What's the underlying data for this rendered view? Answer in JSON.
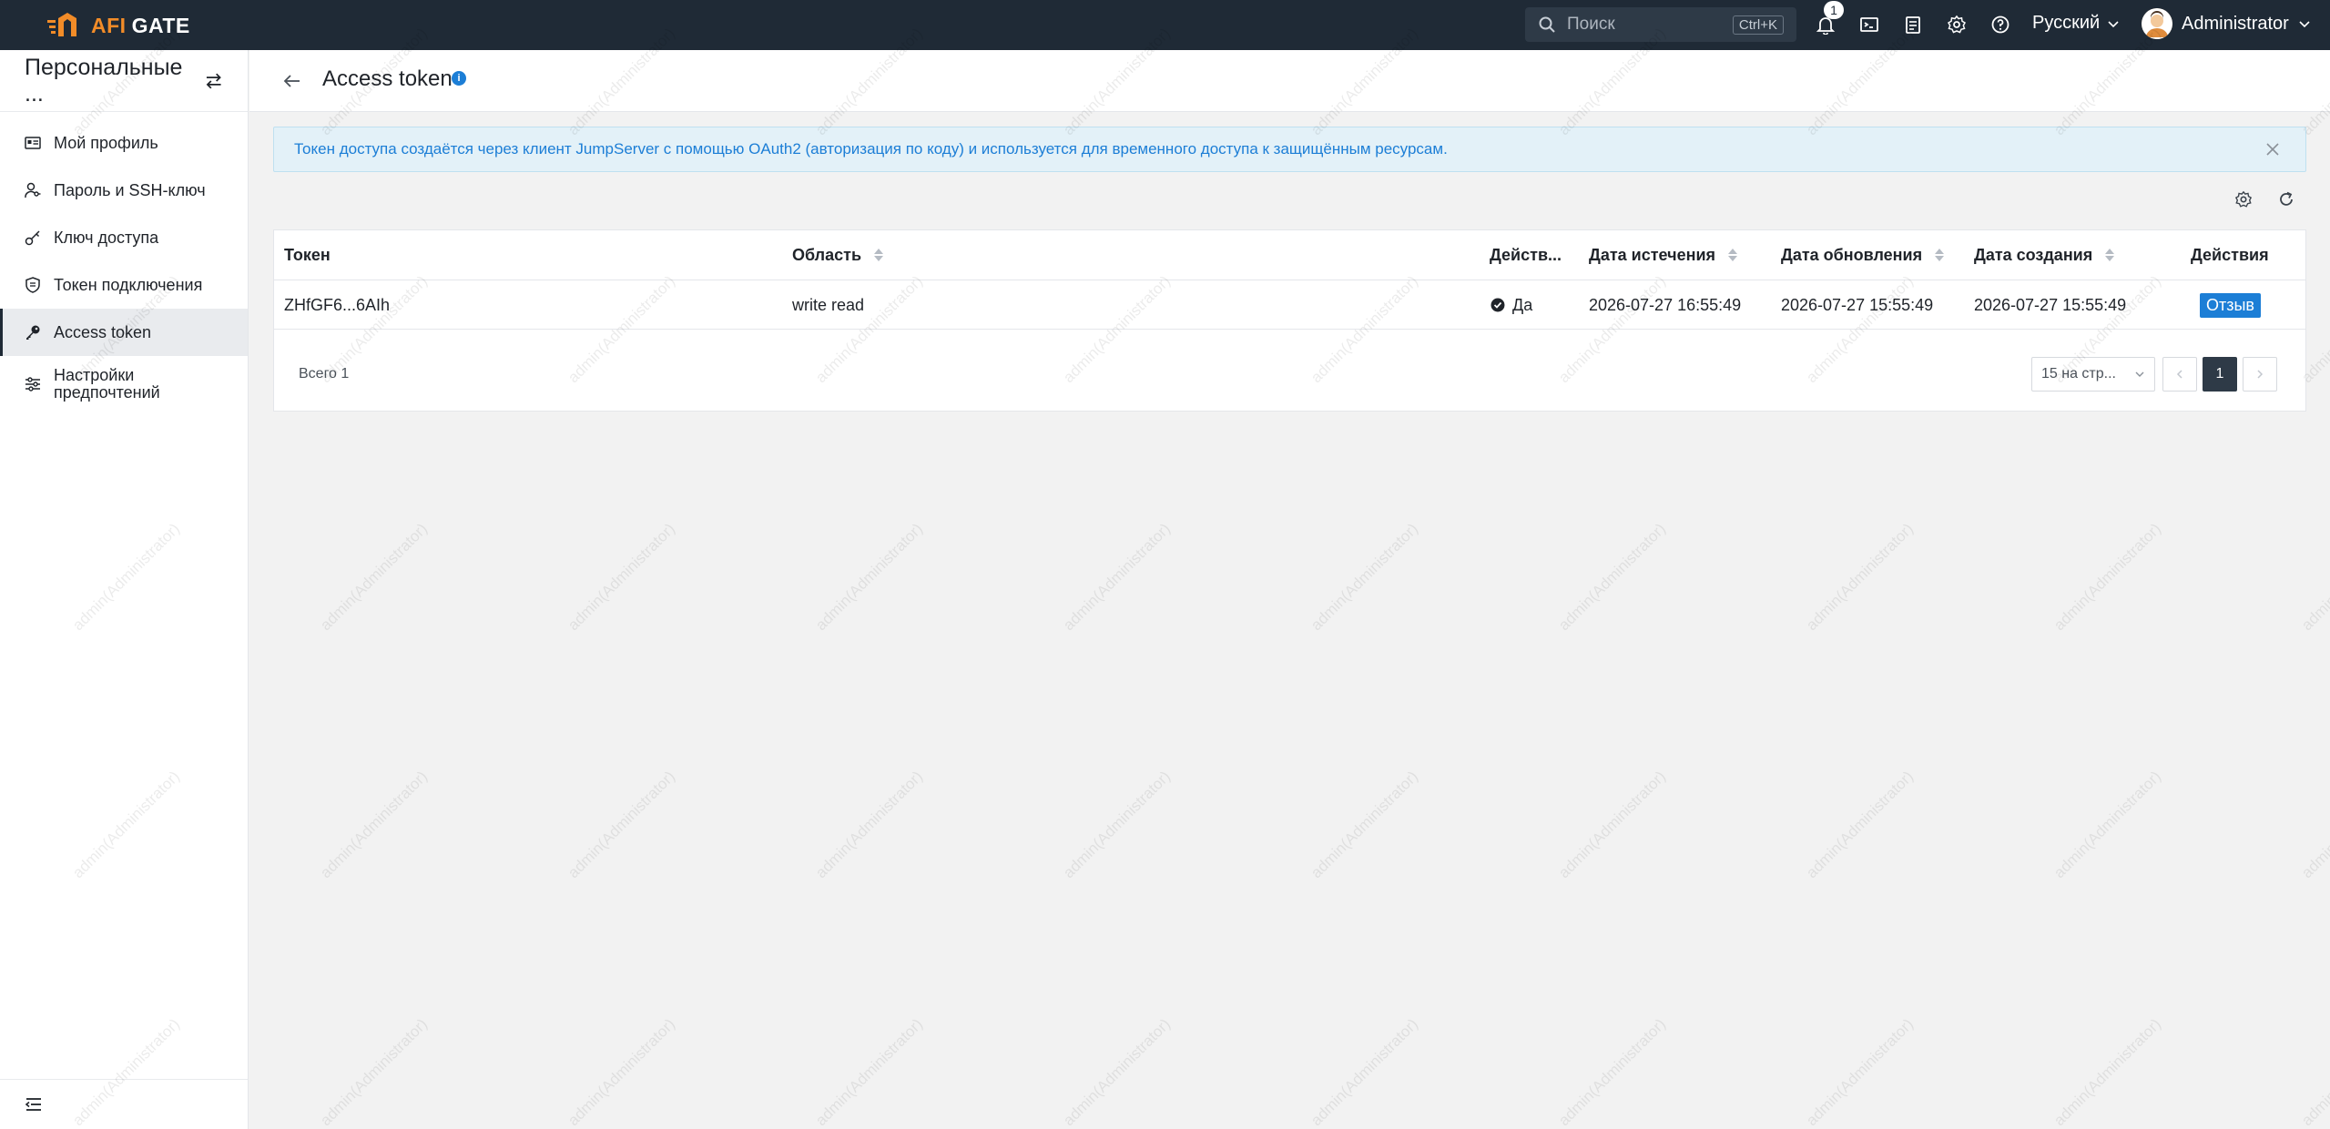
{
  "brand": {
    "afi": "AFI",
    "gate": "GATE",
    "accent": "#f28c28"
  },
  "search": {
    "placeholder": "Поиск",
    "shortcut": "Ctrl+K"
  },
  "notifications": {
    "count": "1"
  },
  "language": "Русский",
  "user": {
    "name": "Administrator"
  },
  "sidebar": {
    "title": "Персональные ...",
    "items": [
      {
        "label": "Мой профиль",
        "icon": "profile-card-icon"
      },
      {
        "label": "Пароль и SSH-ключ",
        "icon": "user-key-icon"
      },
      {
        "label": "Ключ доступа",
        "icon": "key-icon"
      },
      {
        "label": "Токен подключения",
        "icon": "shield-icon"
      },
      {
        "label": "Access token",
        "icon": "key-solid-icon",
        "active": true
      },
      {
        "label": "Настройки предпочтений",
        "icon": "sliders-icon"
      }
    ]
  },
  "page": {
    "title": "Access token"
  },
  "alert": {
    "text": "Токен доступа создаётся через клиент JumpServer с помощью OAuth2 (авторизация по коду) и используется для временного доступа к защищённым ресурсам."
  },
  "table": {
    "headers": {
      "token": "Токен",
      "scope": "Область",
      "active": "Действ...",
      "expires": "Дата истечения",
      "updated": "Дата обновления",
      "created": "Дата создания",
      "actions": "Действия"
    },
    "rows": [
      {
        "token": "ZHfGF6...6AIh",
        "scope": "write read",
        "active": "Да",
        "expires": "2026-07-27 16:55:49",
        "updated": "2026-07-27 15:55:49",
        "created": "2026-07-27 15:55:49",
        "action": "Отзыв"
      }
    ]
  },
  "pagination": {
    "total": "Всего 1",
    "page_size": "15 на стр...",
    "current": "1"
  },
  "watermark": "admin(Administrator)"
}
